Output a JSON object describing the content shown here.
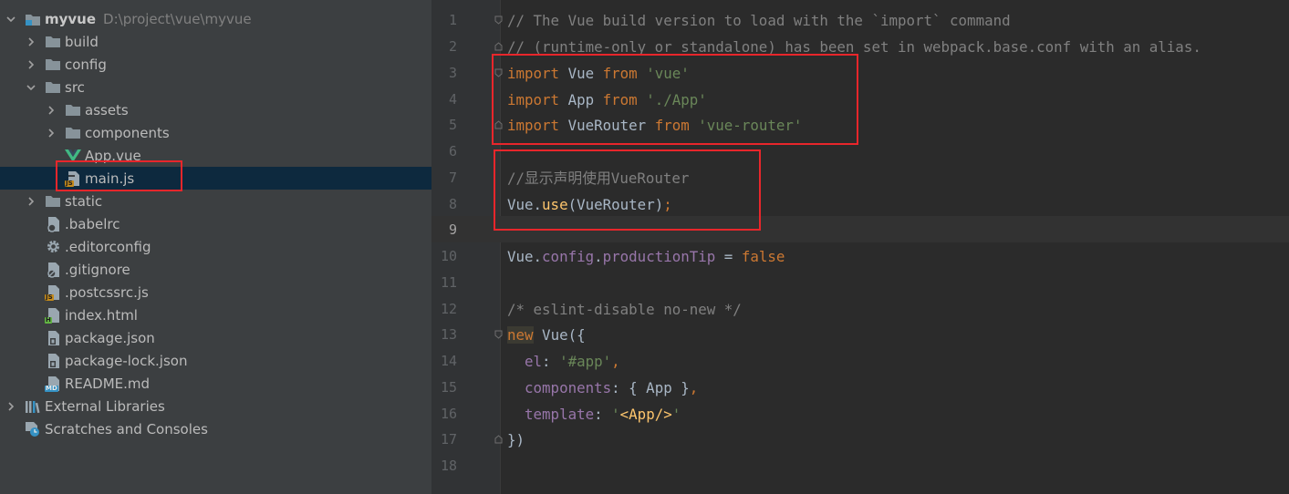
{
  "project": {
    "name": "myvue",
    "path": "D:\\project\\vue\\myvue"
  },
  "tree": {
    "items": [
      {
        "label": "build",
        "kind": "folder"
      },
      {
        "label": "config",
        "kind": "folder"
      },
      {
        "label": "src",
        "kind": "folder"
      },
      {
        "label": "assets",
        "kind": "folder"
      },
      {
        "label": "components",
        "kind": "folder"
      },
      {
        "label": "App.vue",
        "kind": "vue-file"
      },
      {
        "label": "main.js",
        "kind": "js-file"
      },
      {
        "label": "static",
        "kind": "folder"
      },
      {
        "label": ".babelrc",
        "kind": "config-file"
      },
      {
        "label": ".editorconfig",
        "kind": "gear-file"
      },
      {
        "label": ".gitignore",
        "kind": "ignore-file"
      },
      {
        "label": ".postcssrc.js",
        "kind": "js-file"
      },
      {
        "label": "index.html",
        "kind": "html-file"
      },
      {
        "label": "package.json",
        "kind": "json-file"
      },
      {
        "label": "package-lock.json",
        "kind": "json-file"
      },
      {
        "label": "README.md",
        "kind": "md-file"
      },
      {
        "label": "External Libraries",
        "kind": "library"
      },
      {
        "label": "Scratches and Consoles",
        "kind": "scratch"
      }
    ]
  },
  "editor": {
    "line_numbers": [
      "1",
      "2",
      "3",
      "4",
      "5",
      "6",
      "7",
      "8",
      "9",
      "10",
      "11",
      "12",
      "13",
      "14",
      "15",
      "16",
      "17",
      "18"
    ],
    "current_line": "9",
    "lines": {
      "l1": "// The Vue build version to load with the `import` command",
      "l2": "// (runtime-only or standalone) has been set in webpack.base.conf with an alias.",
      "l3_kw1": "import",
      "l3_id": " Vue ",
      "l3_kw2": "from",
      "l3_str": " 'vue'",
      "l4_kw1": "import",
      "l4_id": " App ",
      "l4_kw2": "from",
      "l4_str": " './App'",
      "l5_kw1": "import",
      "l5_id": " VueRouter ",
      "l5_kw2": "from",
      "l5_str": " 'vue-router'",
      "l7": "//显示声明使用VueRouter",
      "l8_a": "Vue.",
      "l8_fn": "use",
      "l8_b": "(VueRouter)",
      "l8_semi": ";",
      "l10_a": "Vue.",
      "l10_p1": "config",
      "l10_dot": ".",
      "l10_p2": "productionTip",
      "l10_eq": " = ",
      "l10_kw": "false",
      "l12": "/* eslint-disable no-new */",
      "l13_kw": "new",
      "l13_rest": " Vue({",
      "l14_p": "  el",
      "l14_c": ": ",
      "l14_s": "'#app'",
      "l14_comma": ",",
      "l15_p": "  components",
      "l15_rest": ": { App }",
      "l15_comma": ",",
      "l16_p": "  template",
      "l16_c": ": ",
      "l16_q1": "'",
      "l16_tag": "<App/>",
      "l16_q2": "'",
      "l17": "})"
    }
  },
  "colors": {
    "annotation": "#e8262b",
    "selection": "#0d293e",
    "keyword": "#cc7832",
    "string": "#6a8759",
    "comment": "#808080",
    "property": "#9876aa",
    "function": "#ffc66d"
  }
}
